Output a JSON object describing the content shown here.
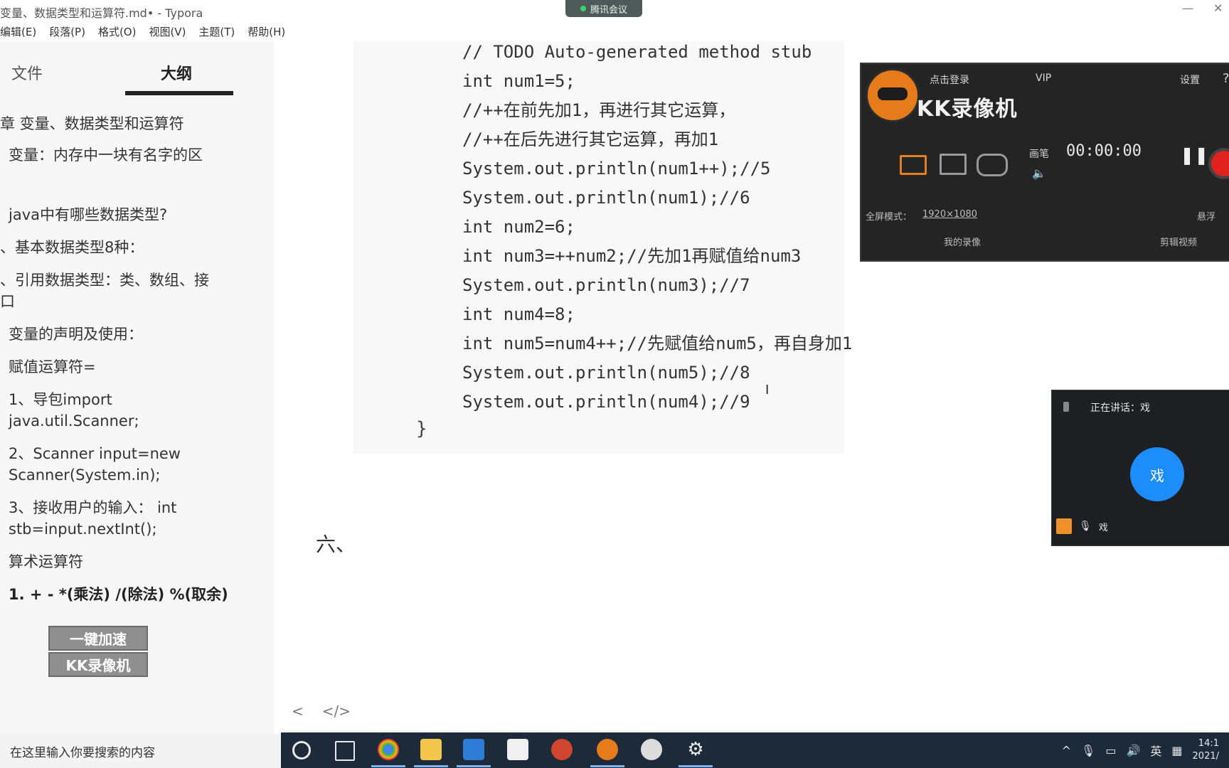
{
  "window": {
    "title": "变量、数据类型和运算符.md• - Typora",
    "minimize": "—",
    "close": "✕"
  },
  "meeting_pill": {
    "label": "腾讯会议"
  },
  "menu": [
    "编辑(E)",
    "段落(P)",
    "格式(O)",
    "视图(V)",
    "主题(T)",
    "帮助(H)"
  ],
  "sidebar": {
    "tabs": [
      "文件",
      "大纲"
    ],
    "active_tab": "大纲",
    "outline": [
      {
        "text": "章 变量、数据类型和运算符",
        "bold": false
      },
      {
        "text": "变量：内存中一块有名字的区",
        "bold": false
      },
      {
        "text": "java中有哪些数据类型?",
        "bold": false
      },
      {
        "text": "、基本数据类型8种：",
        "bold": false
      },
      {
        "text": "、引用数据类型：类、数组、接",
        "bold": false
      },
      {
        "text": "口",
        "bold": false
      },
      {
        "text": "变量的声明及使用：",
        "bold": false
      },
      {
        "text": "赋值运算符=",
        "bold": false
      },
      {
        "text": "1、导包import",
        "bold": false
      },
      {
        "text": "java.util.Scanner;",
        "bold": false
      },
      {
        "text": "2、Scanner input=new",
        "bold": false
      },
      {
        "text": "Scanner(System.in);",
        "bold": false
      },
      {
        "text": "3、接收用户的输入： int",
        "bold": false
      },
      {
        "text": "stb=input.nextInt();",
        "bold": false
      },
      {
        "text": "算术运算符",
        "bold": false
      },
      {
        "text": "1. + - *(乘法) /(除法) %(取余)",
        "bold": true
      }
    ],
    "watermark": [
      "一键加速",
      "KK录像机"
    ],
    "bottom_icons": [
      "<",
      "</>"
    ]
  },
  "editor": {
    "code_lines": [
      "// TODO Auto-generated method stub",
      "int num1=5;",
      "//++在前先加1，再进行其它运算，",
      "//++在后先进行其它运算，再加1",
      "System.out.println(num1++);//5",
      "System.out.println(num1);//6",
      "int num2=6;",
      "int num3=++num2;//先加1再赋值给num3",
      "System.out.println(num3);//7",
      "int num4=8;",
      "int num5=num4++;//先赋值给num5，再自身加1",
      "System.out.println(num5);//8",
      "System.out.println(num4);//9"
    ],
    "closing_brace": "}",
    "heading_fragment": "六、",
    "cursor": "I"
  },
  "kk_recorder": {
    "login": "点击登录",
    "vip": "VIP",
    "settings": "设置",
    "help": "?",
    "brand": "KK录像机",
    "paint": "画笔",
    "timer": "00:00:00",
    "pause": "❚❚",
    "resolution_label": "全屏模式：",
    "resolution_value": "1920×1080",
    "float": "悬浮",
    "my_recordings": "我的录像",
    "edit_video": "剪辑视频",
    "accent_color": "#e2801d",
    "record_color": "#e0221f"
  },
  "speaker_panel": {
    "title": "正在讲话：戏",
    "avatar_text": "戏",
    "name": "戏",
    "avatar_color": "#1e8dfc"
  },
  "taskbar": {
    "search_placeholder": "在这里输入你要搜索的内容",
    "icons": [
      "cortana-icon",
      "task-view-icon",
      "chrome-icon",
      "file-explorer-icon",
      "app-icon",
      "notes-icon",
      "powerpoint-icon",
      "kk-recorder-icon",
      "app-icon-2",
      "settings-icon"
    ],
    "tray": {
      "chevron": "^",
      "ime": "英",
      "time": "14:1",
      "date": "2021/"
    }
  }
}
